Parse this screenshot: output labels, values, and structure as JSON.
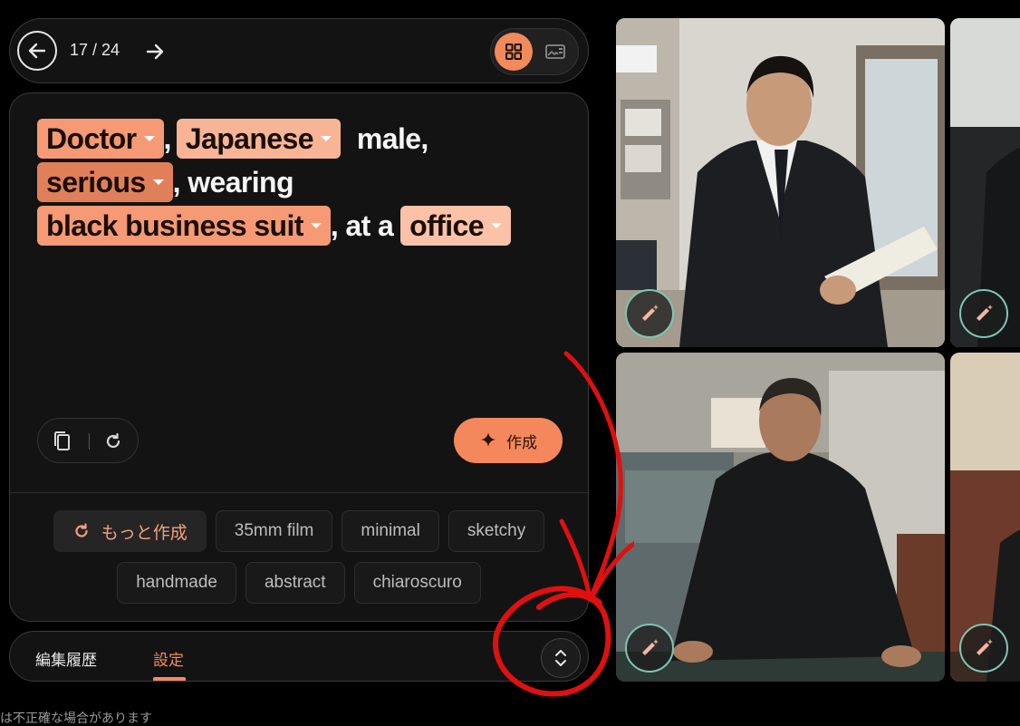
{
  "nav": {
    "counter": "17 / 24"
  },
  "prompt": {
    "line1": {
      "chip1": "Doctor",
      "sep1": ",",
      "chip2": "Japanese",
      "text1": "male,"
    },
    "line2": {
      "chip1": "serious",
      "text1": ", wearing"
    },
    "line3": {
      "chip1": "black business suit",
      "text1": ", at a",
      "chip2": "office"
    }
  },
  "actions": {
    "create_label": "作成"
  },
  "styles": {
    "more_label": "もっと作成",
    "chips": [
      "35mm film",
      "minimal",
      "sketchy",
      "handmade",
      "abstract",
      "chiaroscuro"
    ]
  },
  "tabs": {
    "history": "編集履歴",
    "settings": "設定"
  },
  "footer": {
    "disclaimer": "は不正確な場合があります"
  },
  "colors": {
    "accent": "#f4885c",
    "annotation": "#e01010",
    "edit_ring": "#7fc5b4"
  }
}
